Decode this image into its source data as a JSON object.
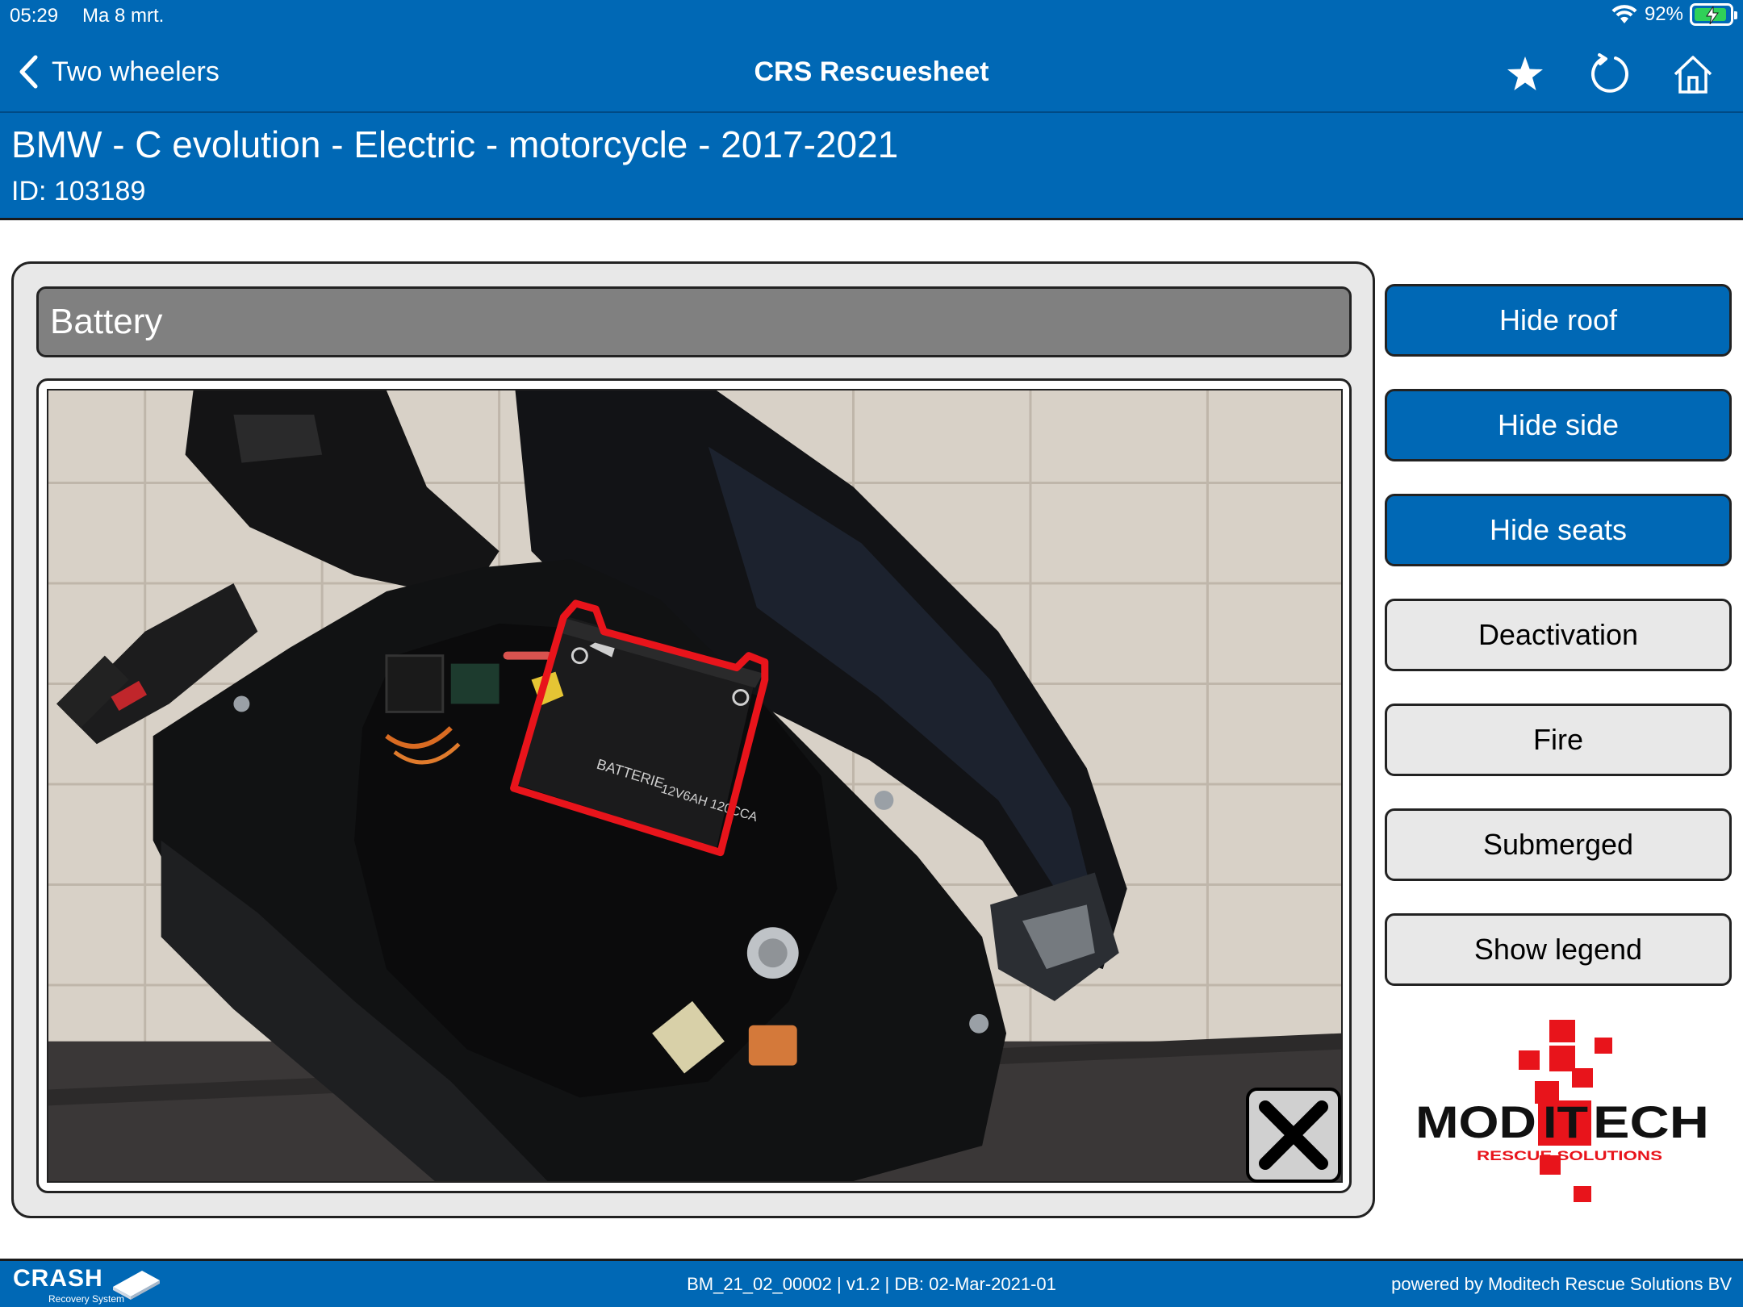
{
  "status_bar": {
    "time": "05:29",
    "date": "Ma 8 mrt.",
    "battery_percent": "92%",
    "battery_level": 0.92,
    "charging": true
  },
  "nav": {
    "back_label": "Two wheelers",
    "title": "CRS Rescuesheet",
    "icons": [
      "star-icon",
      "refresh-icon",
      "home-icon"
    ]
  },
  "vehicle": {
    "title": "BMW - C evolution - Electric - motorcycle - 2017-2021",
    "id_line": "ID: 103189"
  },
  "panel": {
    "title": "Battery",
    "image_description_icons": [
      "battery-highlight",
      "close-icon"
    ]
  },
  "side_buttons": [
    {
      "label": "Hide roof",
      "style": "blue"
    },
    {
      "label": "Hide side",
      "style": "blue"
    },
    {
      "label": "Hide seats",
      "style": "blue"
    },
    {
      "label": "Deactivation",
      "style": "grey"
    },
    {
      "label": "Fire",
      "style": "grey"
    },
    {
      "label": "Submerged",
      "style": "grey"
    },
    {
      "label": "Show legend",
      "style": "grey"
    }
  ],
  "logo": {
    "brand_left": "MOD",
    "brand_mid": "IT",
    "brand_right": "ECH",
    "tagline": "RESCUE SOLUTIONS"
  },
  "footer": {
    "brand": "CRASH",
    "brand_sub": "Recovery System",
    "version_info": "BM_21_02_00002 | v1.2 | DB: 02-Mar-2021-01",
    "powered_by": "powered by Moditech Rescue Solutions BV"
  },
  "colors": {
    "header_blue": "#0068b5",
    "highlight_red": "#e8141b",
    "panel_grey": "#e8e8e8",
    "title_grey": "#808080"
  }
}
